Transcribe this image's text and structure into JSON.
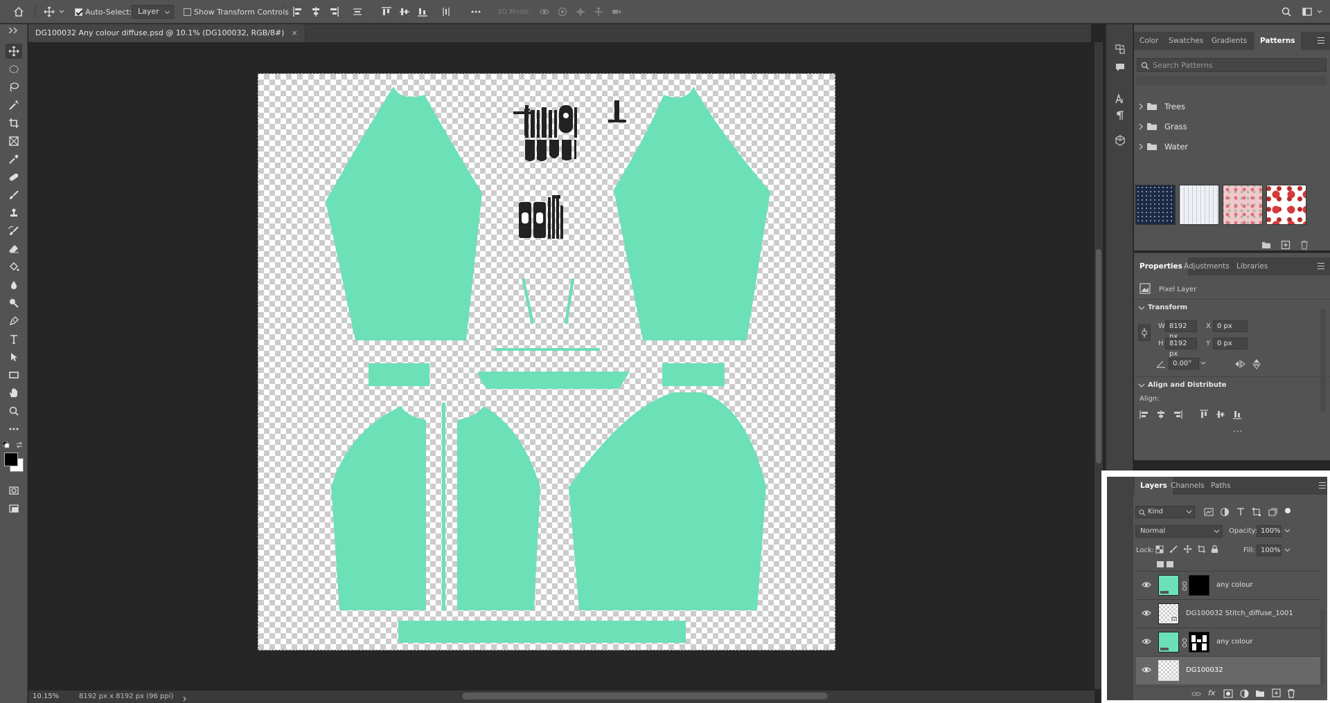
{
  "colors": {
    "garment": "#6ce0b7",
    "chrome": "#535353",
    "canvas_bg": "#262626"
  },
  "options_bar": {
    "auto_select_label": "Auto-Select:",
    "auto_select_checked": true,
    "auto_select_target": "Layer",
    "show_transform_label": "Show Transform Controls",
    "mode_3d_label": "3D Mode:"
  },
  "document": {
    "tab_title": "DG100032 Any colour diffuse.psd @ 10.1% (DG100032, RGB/8#)",
    "close_glyph": "×"
  },
  "status": {
    "zoom": "10.15%",
    "doc_info": "8192 px x 8192 px (96 ppi)"
  },
  "top_panel": {
    "tabs": [
      "Color",
      "Swatches",
      "Gradients",
      "Patterns"
    ],
    "active_tab": "Patterns",
    "search_placeholder": "Search Patterns",
    "groups": [
      "Trees",
      "Grass",
      "Water"
    ]
  },
  "properties_panel": {
    "tabs": [
      "Properties",
      "Adjustments",
      "Libraries"
    ],
    "layer_type": "Pixel Layer",
    "transform_title": "Transform",
    "w_label": "W",
    "w_value": "8192 px",
    "h_label": "H",
    "h_value": "8192 px",
    "x_label": "X",
    "x_value": "0 px",
    "y_label": "Y",
    "y_value": "0 px",
    "angle_value": "0.00°",
    "align_title": "Align and Distribute",
    "align_label": "Align:",
    "more_glyph": "..."
  },
  "layers_panel": {
    "tabs": [
      "Layers",
      "Channels",
      "Paths"
    ],
    "filter_kind": "Kind",
    "blend_mode": "Normal",
    "opacity_label": "Opacity:",
    "opacity_value": "100%",
    "lock_label": "Lock:",
    "fill_label": "Fill:",
    "fill_value": "100%",
    "fx_label": "fx",
    "layers": [
      {
        "name": "any colour"
      },
      {
        "name": "DG100032 Stitch_diffuse_1001"
      },
      {
        "name": "any colour"
      },
      {
        "name": "DG100032"
      }
    ],
    "selected_layer": "DG100032"
  }
}
